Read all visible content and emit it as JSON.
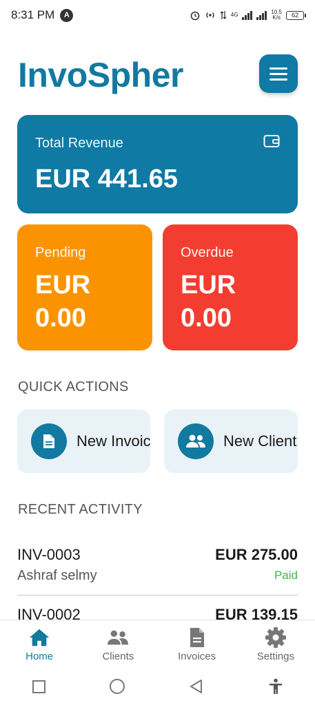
{
  "status_bar": {
    "time": "8:31 PM",
    "notification_badge": "A",
    "net_type": "4G",
    "net_speed_value": "10.5",
    "net_speed_unit": "K/s",
    "battery": "62"
  },
  "header": {
    "title": "InvoSpher",
    "menu_icon": "hamburger-menu-icon"
  },
  "summary": {
    "revenue": {
      "label": "Total Revenue",
      "value": "EUR 441.65",
      "icon": "wallet-icon"
    },
    "pending": {
      "label": "Pending",
      "value": "EUR 0.00",
      "color": "#fb9300"
    },
    "overdue": {
      "label": "Overdue",
      "value": "EUR 0.00",
      "color": "#f43d31"
    }
  },
  "quick_actions": {
    "title": "QUICK ACTIONS",
    "items": [
      {
        "label": "New Invoice",
        "icon": "document-icon"
      },
      {
        "label": "New Client",
        "icon": "users-icon"
      }
    ]
  },
  "recent_activity": {
    "title": "RECENT ACTIVITY",
    "items": [
      {
        "invoice": "INV-0003",
        "amount": "EUR 275.00",
        "client": "Ashraf selmy",
        "status": "Paid"
      },
      {
        "invoice": "INV-0002",
        "amount": "EUR 139.15"
      }
    ]
  },
  "bottom_nav": {
    "items": [
      {
        "label": "Home",
        "icon": "home-icon",
        "active": true
      },
      {
        "label": "Clients",
        "icon": "users-icon"
      },
      {
        "label": "Invoices",
        "icon": "document-icon"
      },
      {
        "label": "Settings",
        "icon": "gear-icon"
      }
    ]
  },
  "colors": {
    "brand": "#127aa0",
    "paid": "#3cb84a"
  }
}
